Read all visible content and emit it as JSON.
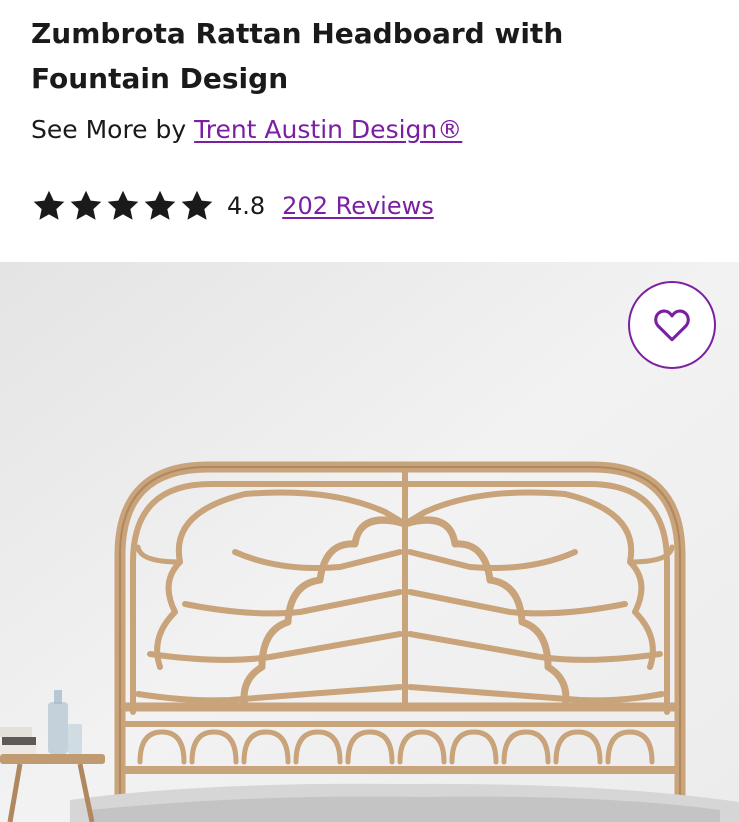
{
  "product": {
    "title": "Zumbrota Rattan Headboard with Fountain Design",
    "see_more_prefix": "See More by",
    "brand_link": "Trent Austin Design®",
    "rating": "4.8",
    "rating_stars": 5,
    "reviews_link": "202 Reviews"
  },
  "image": {
    "description_icon": "product-photo",
    "favorite_icon": "heart-outline-icon"
  },
  "colors": {
    "accent": "#7b1fa2",
    "text": "#1a1a1a",
    "rattan": "#c9a37a"
  }
}
